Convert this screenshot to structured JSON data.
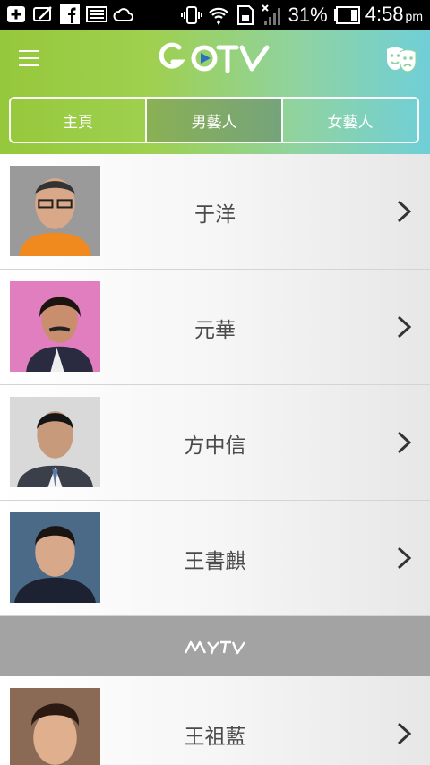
{
  "status_bar": {
    "battery_percent": "31%",
    "time": "4:58",
    "ampm": "pm",
    "icons": [
      "add-icon",
      "notes-icon",
      "facebook-icon",
      "gallery-icon",
      "cloud-icon",
      "vibrate-icon",
      "wifi-icon",
      "sim-icon",
      "signal-icon",
      "battery-icon"
    ]
  },
  "header": {
    "logo_text": "GOTV",
    "menu_icon": "hamburger-menu-icon",
    "right_icon": "theater-masks-icon",
    "accent_colors": [
      "#96c83c",
      "#6fcfd8"
    ]
  },
  "tabs": [
    {
      "label": "主頁",
      "active": false
    },
    {
      "label": "男藝人",
      "active": true
    },
    {
      "label": "女藝人",
      "active": false
    }
  ],
  "artists": [
    {
      "name": "于洋",
      "photo_bg": "#a9a9a9"
    },
    {
      "name": "元華",
      "photo_bg": "#d97ab8"
    },
    {
      "name": "方中信",
      "photo_bg": "#d6d6d6"
    },
    {
      "name": "王書麒",
      "photo_bg": "#4d6b86"
    }
  ],
  "banner": {
    "logo_text": "MYTV"
  },
  "artists_after_banner": [
    {
      "name": "王祖藍",
      "photo_bg": "#8a6a55"
    }
  ]
}
